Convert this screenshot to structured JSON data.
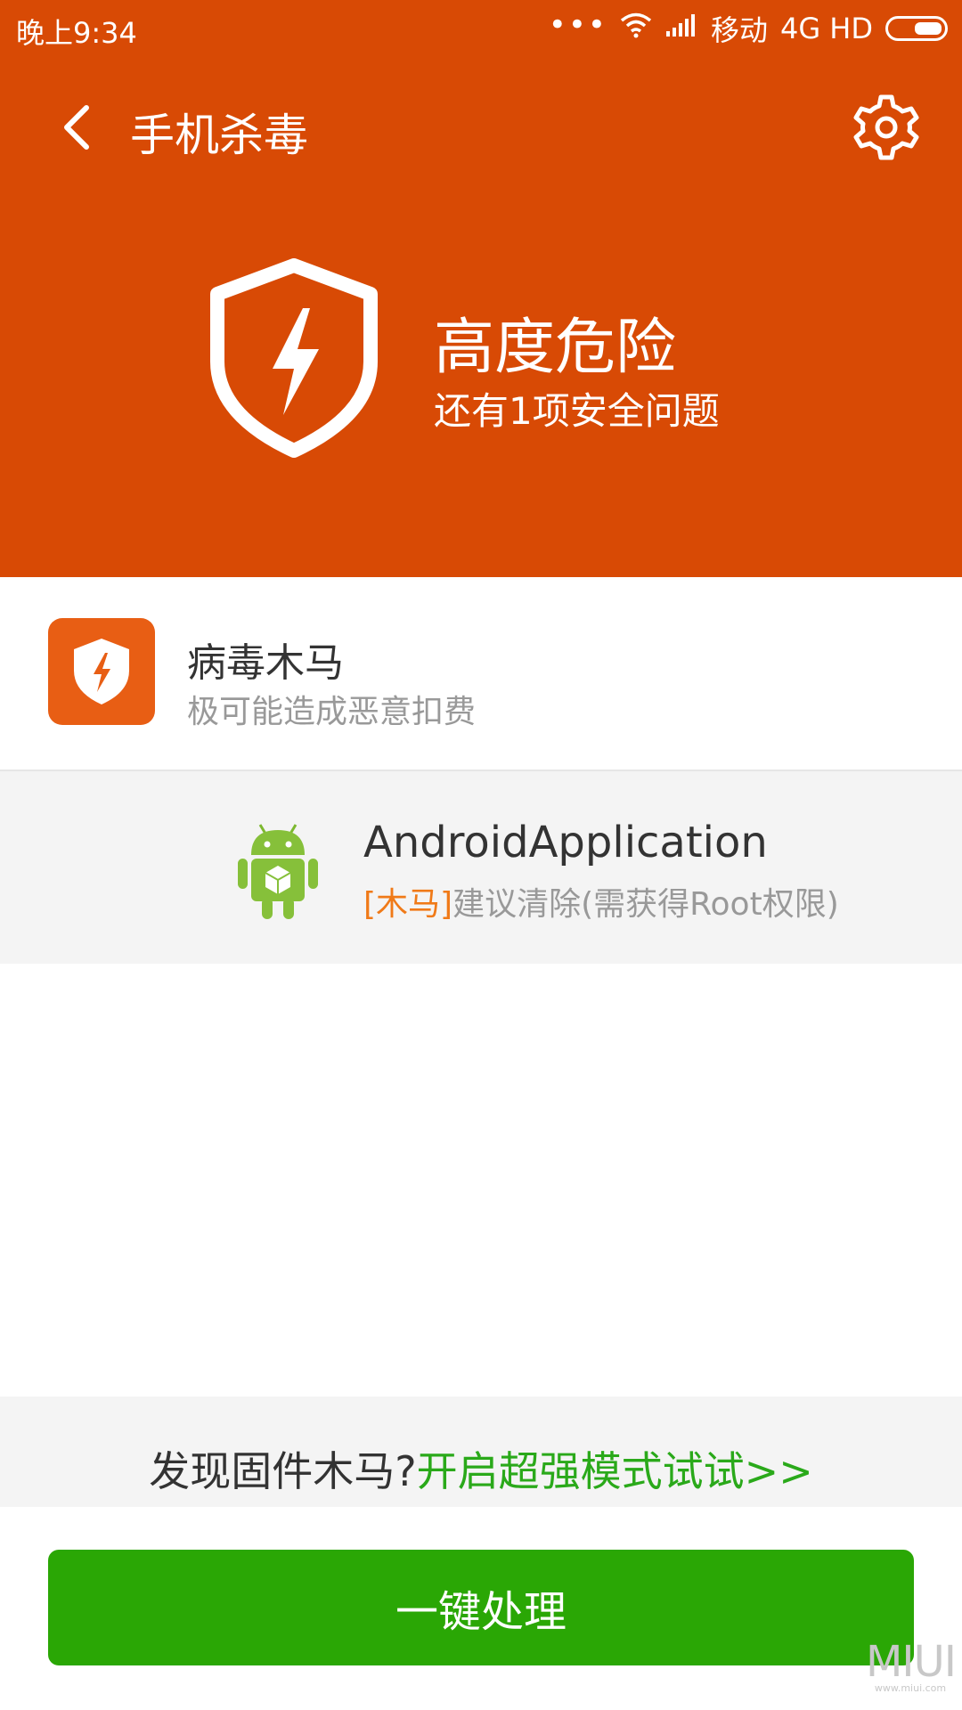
{
  "status_bar": {
    "time": "晚上9:34",
    "dots": "•••",
    "carrier": "移动",
    "network": "4G HD"
  },
  "header": {
    "title": "手机杀毒",
    "background_color": "#d84a05",
    "back_icon": "chevron-left-icon",
    "settings_icon": "gear-icon"
  },
  "risk": {
    "level": "高度危险",
    "summary": "还有1项安全问题",
    "icon": "shield-lightning-icon"
  },
  "threat_category": {
    "title": "病毒木马",
    "description": "极可能造成恶意扣费",
    "icon": "shield-lightning-icon",
    "icon_color": "#e85e14"
  },
  "infected_app": {
    "name": "AndroidApplication",
    "tag": "[木马]",
    "action": "建议清除(需获得Root权限)",
    "icon": "android-app-icon",
    "tag_color": "#f07a18"
  },
  "promo": {
    "question": "发现固件木马?",
    "link": "开启超强模式试试>>",
    "link_color": "#2aa91a"
  },
  "action_button": {
    "label": "一键处理",
    "color": "#2aa705"
  },
  "watermark": {
    "brand": "MIUI",
    "site": "www.miui.com"
  }
}
